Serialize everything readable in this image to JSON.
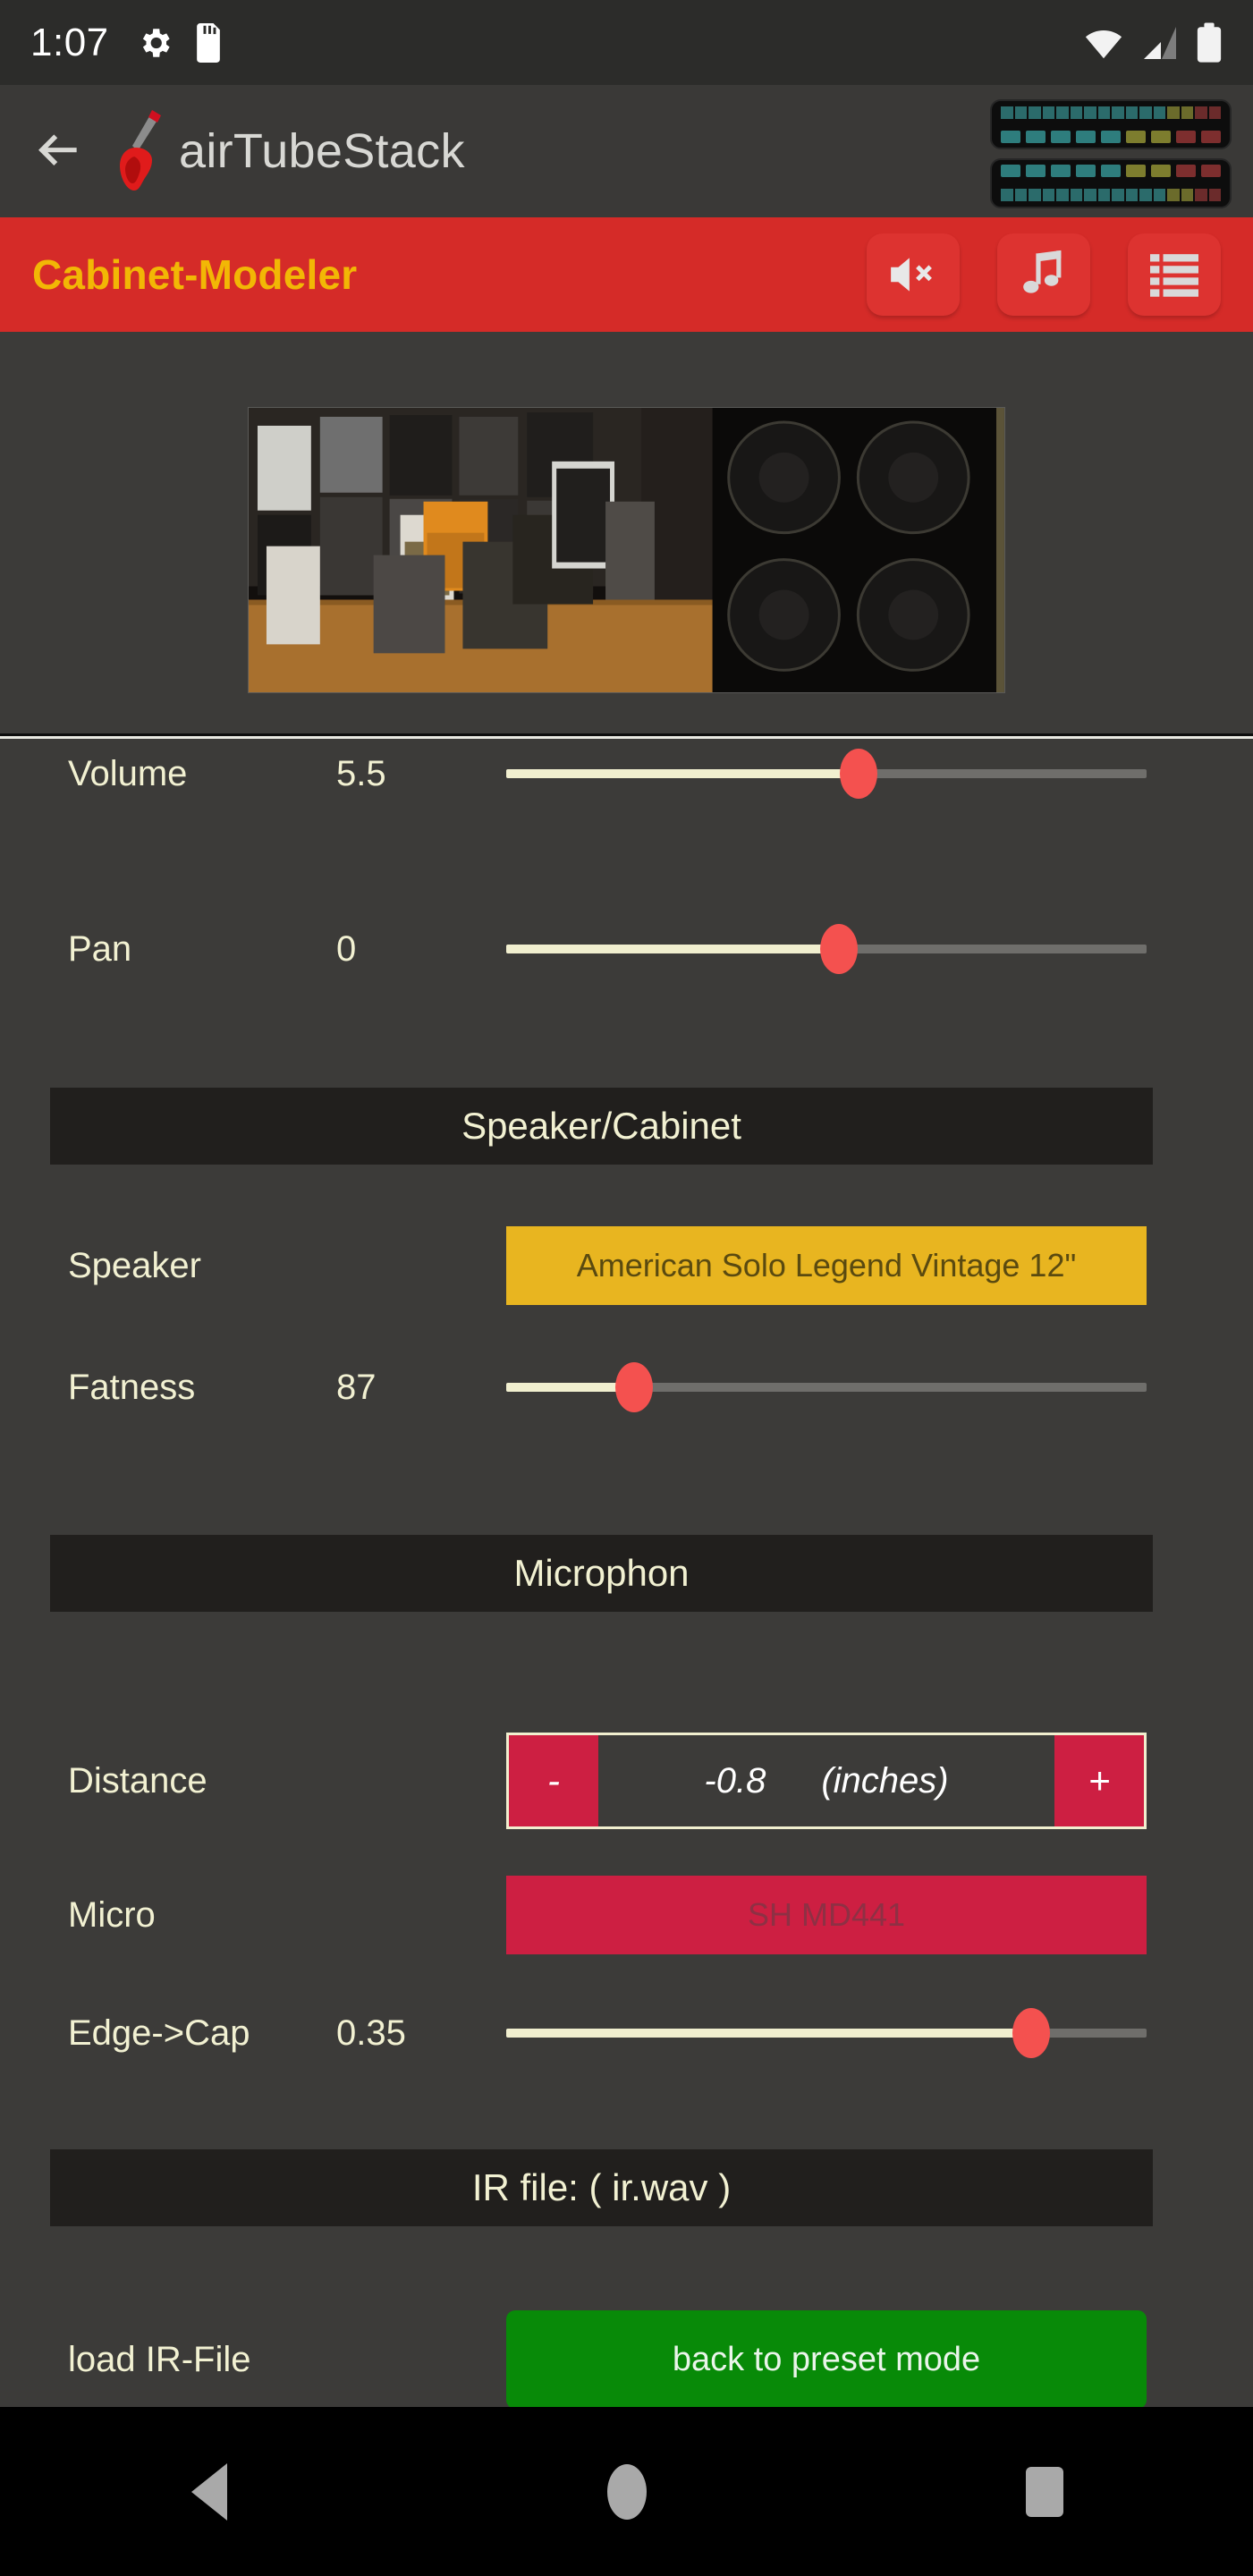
{
  "statusbar": {
    "time": "1:07",
    "icons": [
      "gear-icon",
      "sd-card-icon",
      "wifi-icon",
      "cell-signal-icon",
      "battery-icon"
    ]
  },
  "appbar": {
    "back_label": "back",
    "title": "airTubeStack",
    "logo": "electric-guitar-icon",
    "meters": [
      "vu-meter-left",
      "vu-meter-right"
    ]
  },
  "toolbar": {
    "title": "Cabinet-Modeler",
    "buttons": [
      {
        "name": "mute-button",
        "icon": "speaker-mute-icon"
      },
      {
        "name": "music-button",
        "icon": "music-note-icon"
      },
      {
        "name": "list-button",
        "icon": "list-icon"
      }
    ]
  },
  "hero": {
    "alt": "guitar amplifier cabinets photo"
  },
  "mixer": {
    "volume": {
      "label": "Volume",
      "value": "5.5",
      "percent": 55
    },
    "pan": {
      "label": "Pan",
      "value": "0",
      "percent": 52
    }
  },
  "speaker_section": {
    "header": "Speaker/Cabinet",
    "speaker_label": "Speaker",
    "speaker_value": "American Solo Legend Vintage 12\"",
    "fatness_label": "Fatness",
    "fatness_value": "87",
    "fatness_percent": 20
  },
  "microphone_section": {
    "header": "Microphon",
    "distance_label": "Distance",
    "distance_minus": "-",
    "distance_value": "-0.8",
    "distance_unit": "(inches)",
    "distance_plus": "+",
    "micro_label": "Micro",
    "micro_value": "SH MD441",
    "edge_label": "Edge->Cap",
    "edge_value": "0.35",
    "edge_percent": 82
  },
  "ir_section": {
    "header": "IR file: ( ir.wav )",
    "load_label": "load IR-File",
    "preset_button": "back to preset mode"
  },
  "navbar": {
    "back": "nav-back-icon",
    "home": "nav-home-icon",
    "recents": "nav-recents-icon"
  },
  "colors": {
    "toolbar_red": "#d52b28",
    "toolbar_title": "#f2b705",
    "accent_cream": "#f1efcf",
    "thumb_red": "#f4514f",
    "speaker_yellow": "#e8b520",
    "micro_crimson": "#cd1f42",
    "preset_green": "#088a08"
  }
}
